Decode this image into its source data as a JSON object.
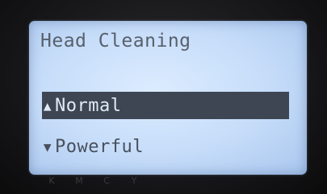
{
  "screen": {
    "title": "Head Cleaning",
    "menu": [
      {
        "label": "Normal",
        "selected": true,
        "arrow_icon": "arrow-up-icon",
        "arrow_glyph": "▲"
      },
      {
        "label": "Powerful",
        "selected": false,
        "arrow_icon": "arrow-down-icon",
        "arrow_glyph": "▼"
      }
    ]
  },
  "ink_labels": [
    "K",
    "M",
    "C",
    "Y"
  ],
  "colors": {
    "lcd_background": "#c5dcf9",
    "highlight": "#3e4654",
    "text": "#58606c"
  }
}
